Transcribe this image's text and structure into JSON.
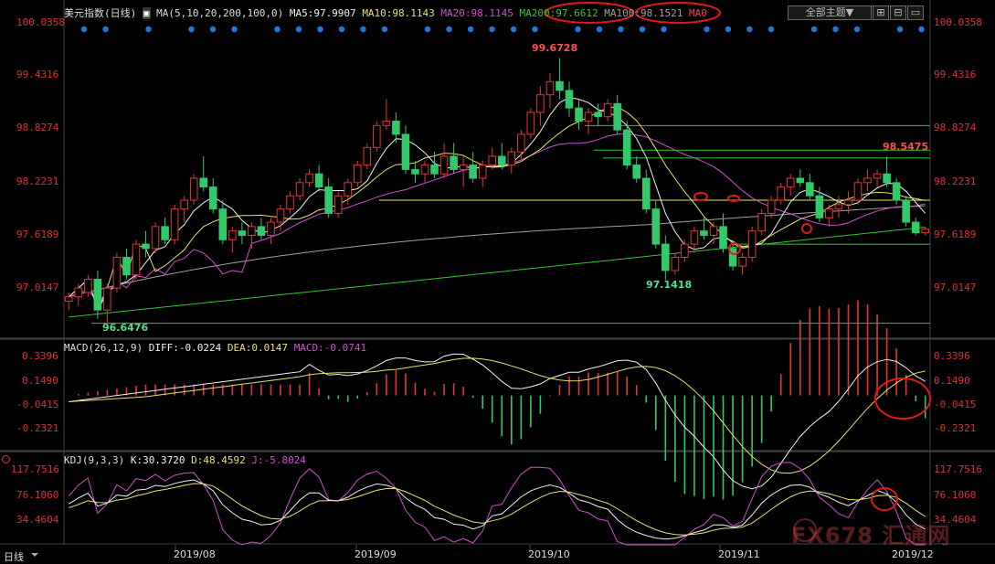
{
  "header": {
    "instrument": "美元指数(日线)",
    "ma_label": "MA(5,10,20,200,100,0)",
    "ma5": "MA5:97.9907",
    "ma10": "MA10:98.1143",
    "ma20": "MA20:98.1145",
    "ma200": "MA200:97.6612",
    "ma100": "MA100:98.1521",
    "ma0": "MA0",
    "theme_button": "全部主题"
  },
  "price_axis": [
    "100.0358",
    "99.4316",
    "98.8274",
    "98.2231",
    "97.6189",
    "97.0147"
  ],
  "annotations": {
    "high": "99.6728",
    "right_high": "98.5475",
    "low_mid": "97.1418",
    "low_left": "96.6476"
  },
  "macd": {
    "label": "MACD(26,12,9)",
    "diff": "DIFF:-0.0224",
    "dea": "DEA:0.0147",
    "macd": "MACD:-0.0741",
    "axis": [
      "0.3396",
      "0.1490",
      "-0.0415",
      "-0.2321"
    ]
  },
  "kdj": {
    "label": "KDJ(9,3,3)",
    "k": "K:30.3720",
    "d": "D:48.4592",
    "j": "J:-5.8024",
    "axis": [
      "117.7516",
      "76.1060",
      "34.4604"
    ]
  },
  "dates": [
    "2019/08",
    "2019/09",
    "2019/10",
    "2019/11",
    "2019/12"
  ],
  "period_button": "日线",
  "watermark": "FX678 汇通网",
  "colors": {
    "up": "#e03838",
    "down": "#33c86a",
    "ma5": "#f0f0f0",
    "ma10": "#e8e070",
    "ma20": "#d050d0",
    "ma200": "#30c830",
    "ma100": "#a0a0a0",
    "axis": "#e03030",
    "circle": "#e01818"
  },
  "chart_data": {
    "type": "candlestick",
    "ylim": [
      96.5,
      100.1
    ],
    "candles": [
      [
        96.9,
        97.0,
        96.8,
        96.95
      ],
      [
        96.95,
        97.1,
        96.85,
        97.05
      ],
      [
        97.0,
        97.2,
        96.95,
        97.15
      ],
      [
        97.15,
        97.25,
        96.7,
        96.8
      ],
      [
        96.8,
        97.1,
        96.62,
        97.05
      ],
      [
        97.05,
        97.45,
        97.0,
        97.4
      ],
      [
        97.4,
        97.5,
        97.15,
        97.2
      ],
      [
        97.2,
        97.6,
        97.15,
        97.55
      ],
      [
        97.55,
        97.7,
        97.4,
        97.5
      ],
      [
        97.5,
        97.8,
        97.45,
        97.75
      ],
      [
        97.75,
        97.85,
        97.55,
        97.6
      ],
      [
        97.6,
        98.0,
        97.55,
        97.95
      ],
      [
        97.95,
        98.1,
        97.8,
        98.05
      ],
      [
        98.05,
        98.35,
        98.0,
        98.3
      ],
      [
        98.3,
        98.55,
        98.15,
        98.2
      ],
      [
        98.2,
        98.3,
        97.9,
        97.95
      ],
      [
        97.95,
        98.05,
        97.55,
        97.6
      ],
      [
        97.6,
        97.75,
        97.45,
        97.7
      ],
      [
        97.7,
        97.8,
        97.55,
        97.65
      ],
      [
        97.65,
        97.8,
        97.5,
        97.75
      ],
      [
        97.75,
        97.85,
        97.6,
        97.65
      ],
      [
        97.65,
        97.85,
        97.55,
        97.8
      ],
      [
        97.8,
        98.0,
        97.7,
        97.95
      ],
      [
        97.95,
        98.15,
        97.9,
        98.1
      ],
      [
        98.1,
        98.3,
        98.05,
        98.25
      ],
      [
        98.25,
        98.4,
        98.2,
        98.35
      ],
      [
        98.35,
        98.45,
        98.15,
        98.2
      ],
      [
        98.2,
        98.3,
        97.85,
        97.9
      ],
      [
        97.9,
        98.15,
        97.85,
        98.1
      ],
      [
        98.1,
        98.3,
        98.0,
        98.25
      ],
      [
        98.25,
        98.5,
        98.2,
        98.45
      ],
      [
        98.45,
        98.7,
        98.4,
        98.65
      ],
      [
        98.65,
        98.95,
        98.6,
        98.9
      ],
      [
        98.9,
        99.2,
        98.85,
        98.95
      ],
      [
        98.95,
        99.05,
        98.7,
        98.8
      ],
      [
        98.8,
        98.9,
        98.35,
        98.4
      ],
      [
        98.4,
        98.5,
        98.25,
        98.35
      ],
      [
        98.35,
        98.5,
        98.25,
        98.45
      ],
      [
        98.45,
        98.6,
        98.3,
        98.35
      ],
      [
        98.35,
        98.7,
        98.3,
        98.55
      ],
      [
        98.55,
        98.7,
        98.35,
        98.4
      ],
      [
        98.4,
        98.55,
        98.2,
        98.45
      ],
      [
        98.45,
        98.6,
        98.25,
        98.3
      ],
      [
        98.3,
        98.5,
        98.2,
        98.45
      ],
      [
        98.45,
        98.65,
        98.4,
        98.55
      ],
      [
        98.55,
        98.7,
        98.4,
        98.45
      ],
      [
        98.45,
        98.65,
        98.35,
        98.6
      ],
      [
        98.6,
        98.85,
        98.5,
        98.8
      ],
      [
        98.8,
        99.1,
        98.75,
        99.05
      ],
      [
        99.05,
        99.35,
        98.9,
        99.25
      ],
      [
        99.25,
        99.5,
        99.1,
        99.4
      ],
      [
        99.4,
        99.67,
        99.2,
        99.3
      ],
      [
        99.3,
        99.4,
        99.0,
        99.1
      ],
      [
        99.1,
        99.2,
        98.85,
        98.95
      ],
      [
        98.95,
        99.1,
        98.8,
        99.05
      ],
      [
        99.05,
        99.15,
        98.9,
        99.0
      ],
      [
        99.0,
        99.2,
        98.95,
        99.15
      ],
      [
        99.15,
        99.25,
        98.8,
        98.85
      ],
      [
        98.85,
        98.95,
        98.4,
        98.45
      ],
      [
        98.45,
        98.55,
        98.25,
        98.3
      ],
      [
        98.3,
        98.4,
        97.9,
        97.95
      ],
      [
        97.95,
        98.05,
        97.5,
        97.55
      ],
      [
        97.55,
        97.65,
        97.14,
        97.25
      ],
      [
        97.25,
        97.45,
        97.2,
        97.4
      ],
      [
        97.4,
        97.6,
        97.35,
        97.55
      ],
      [
        97.55,
        97.75,
        97.45,
        97.7
      ],
      [
        97.7,
        97.85,
        97.6,
        97.65
      ],
      [
        97.65,
        97.8,
        97.55,
        97.75
      ],
      [
        97.75,
        97.9,
        97.45,
        97.5
      ],
      [
        97.5,
        97.6,
        97.25,
        97.3
      ],
      [
        97.3,
        97.45,
        97.2,
        97.4
      ],
      [
        97.4,
        97.75,
        97.35,
        97.7
      ],
      [
        97.7,
        97.95,
        97.65,
        97.9
      ],
      [
        97.9,
        98.1,
        97.85,
        98.05
      ],
      [
        98.05,
        98.25,
        98.0,
        98.2
      ],
      [
        98.2,
        98.35,
        98.1,
        98.3
      ],
      [
        98.3,
        98.4,
        98.2,
        98.25
      ],
      [
        98.25,
        98.35,
        98.05,
        98.1
      ],
      [
        98.1,
        98.2,
        97.8,
        97.85
      ],
      [
        97.85,
        98.0,
        97.75,
        97.95
      ],
      [
        97.95,
        98.1,
        97.85,
        98.0
      ],
      [
        98.0,
        98.15,
        97.9,
        98.05
      ],
      [
        98.05,
        98.3,
        98.0,
        98.25
      ],
      [
        98.25,
        98.4,
        98.15,
        98.3
      ],
      [
        98.3,
        98.4,
        98.2,
        98.35
      ],
      [
        98.35,
        98.55,
        98.2,
        98.25
      ],
      [
        98.25,
        98.3,
        98.0,
        98.05
      ],
      [
        98.05,
        98.1,
        97.75,
        97.8
      ],
      [
        97.8,
        97.85,
        97.65,
        97.68
      ],
      [
        97.68,
        97.75,
        97.65,
        97.72
      ]
    ],
    "series": [
      {
        "name": "MA5"
      },
      {
        "name": "MA10"
      },
      {
        "name": "MA20"
      },
      {
        "name": "MA200"
      },
      {
        "name": "MA100"
      }
    ],
    "macd": {
      "ylim": [
        -0.42,
        0.4
      ]
    },
    "kdj": {
      "ylim": [
        0,
        125
      ]
    }
  }
}
